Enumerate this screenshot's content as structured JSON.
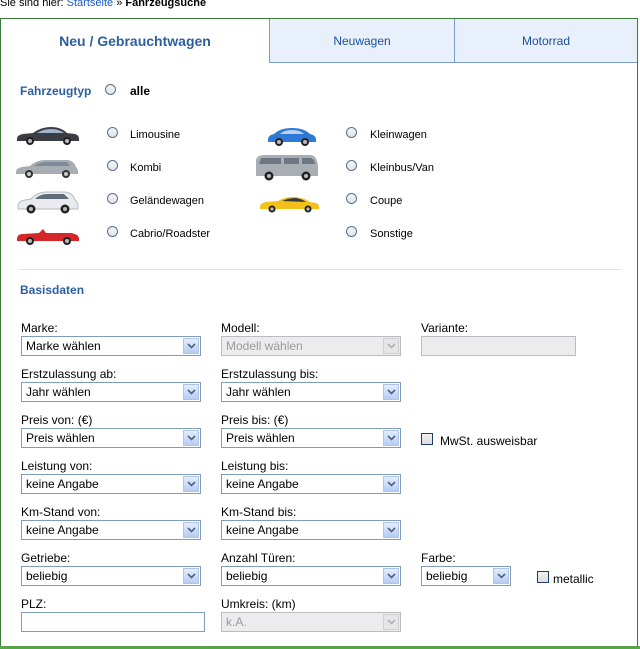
{
  "breadcrumb": {
    "prefix": "Sie sind hier:",
    "home_link": "Startseite",
    "separator": "»",
    "current": "Fahrzeugsuche"
  },
  "tabs": [
    {
      "label": "Neu / Gebrauchtwagen",
      "active": true
    },
    {
      "label": "Neuwagen",
      "active": false
    },
    {
      "label": "Motorrad",
      "active": false
    }
  ],
  "fahrzeugtyp": {
    "title": "Fahrzeugtyp",
    "all_label": "alle",
    "types": [
      {
        "label": "Limousine",
        "icon": "sedan-car-icon",
        "color": "#3a3d44"
      },
      {
        "label": "Kombi",
        "icon": "station-wagon-car-icon",
        "color": "#a8acb3"
      },
      {
        "label": "Geländewagen",
        "icon": "suv-car-icon",
        "color": "#e9ebee"
      },
      {
        "label": "Cabrio/Roadster",
        "icon": "convertible-car-icon",
        "color": "#d6262a"
      },
      {
        "label": "Kleinwagen",
        "icon": "small-car-icon",
        "color": "#2f7ad6"
      },
      {
        "label": "Kleinbus/Van",
        "icon": "van-car-icon",
        "color": "#a9adb4"
      },
      {
        "label": "Coupe",
        "icon": "coupe-car-icon",
        "color": "#f2c11a"
      },
      {
        "label": "Sonstige",
        "icon": "",
        "color": ""
      }
    ]
  },
  "basisdaten": {
    "title": "Basisdaten",
    "marke": {
      "label": "Marke:",
      "value": "Marke wählen"
    },
    "modell": {
      "label": "Modell:",
      "value": "Modell wählen"
    },
    "variante": {
      "label": "Variante:",
      "value": ""
    },
    "ez_ab": {
      "label": "Erstzulassung ab:",
      "value": "Jahr wählen"
    },
    "ez_bis": {
      "label": "Erstzulassung bis:",
      "value": "Jahr wählen"
    },
    "preis_von": {
      "label": "Preis von: (€)",
      "value": "Preis wählen"
    },
    "preis_bis": {
      "label": "Preis bis: (€)",
      "value": "Preis wählen"
    },
    "mwst": {
      "label": "MwSt. ausweisbar"
    },
    "leistung_von": {
      "label": "Leistung von:",
      "value": "keine Angabe"
    },
    "leistung_bis": {
      "label": "Leistung bis:",
      "value": "keine Angabe"
    },
    "km_von": {
      "label": "Km-Stand von:",
      "value": "keine Angabe"
    },
    "km_bis": {
      "label": "Km-Stand bis:",
      "value": "keine Angabe"
    },
    "getriebe": {
      "label": "Getriebe:",
      "value": "beliebig"
    },
    "tueren": {
      "label": "Anzahl Türen:",
      "value": "beliebig"
    },
    "farbe": {
      "label": "Farbe:",
      "value": "beliebig"
    },
    "metallic": {
      "label": "metallic"
    },
    "plz": {
      "label": "PLZ:",
      "value": ""
    },
    "umkreis": {
      "label": "Umkreis: (km)",
      "value": "k.A."
    }
  },
  "colors": {
    "accent_blue": "#2d5f9e",
    "link_blue": "#1a56c8",
    "frame_green": "#3b7a3b",
    "tab_inactive_bg": "#e8f0fb"
  }
}
